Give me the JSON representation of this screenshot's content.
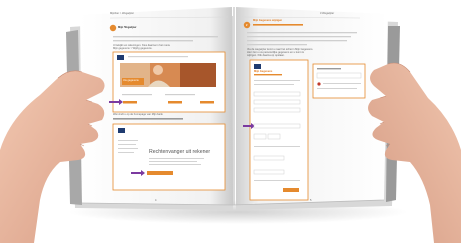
{
  "scene": {
    "subject": "hands-holding-open-book",
    "colors": {
      "page": "#fbfbfb",
      "skin": "#e9b8a0",
      "accent_orange": "#e58a2e",
      "accent_purple": "#7b3aa0",
      "shadow": "#cfcfcf"
    }
  },
  "book": {
    "left_page": {
      "header_left": "Mijnhier > Wegwijzer",
      "header_right": "",
      "section_number": "1",
      "section_title": "Mijn Wegwijzer",
      "intro_line1": "U bekijkt uw rekeningen. Kies daarna in het menu",
      "intro_line2": "Mijn gegevens > Wijzig gegevens.",
      "caption": "Wat vindt u op de homepage van Mijn bank",
      "banner_title": "Uw gegevens",
      "promo_heading": "Rechtenvanger uit rekener",
      "page_number": "4"
    },
    "right_page": {
      "header_left": "",
      "header_right": "3 Wegwijzer",
      "section_number": "2",
      "section_title": "Mijn Gegevens wijzigen",
      "intro_line1": "Via de wegwijzer komt u naar het scherm Mijn Gegevens.",
      "intro_line2": "Hier ziet u uw persoonlijke gegevens en u kunt ze",
      "intro_line3": "wijzigen. Klik daarna op opslaan.",
      "box_title": "Mijn Gegevens",
      "page_number": "5"
    }
  }
}
